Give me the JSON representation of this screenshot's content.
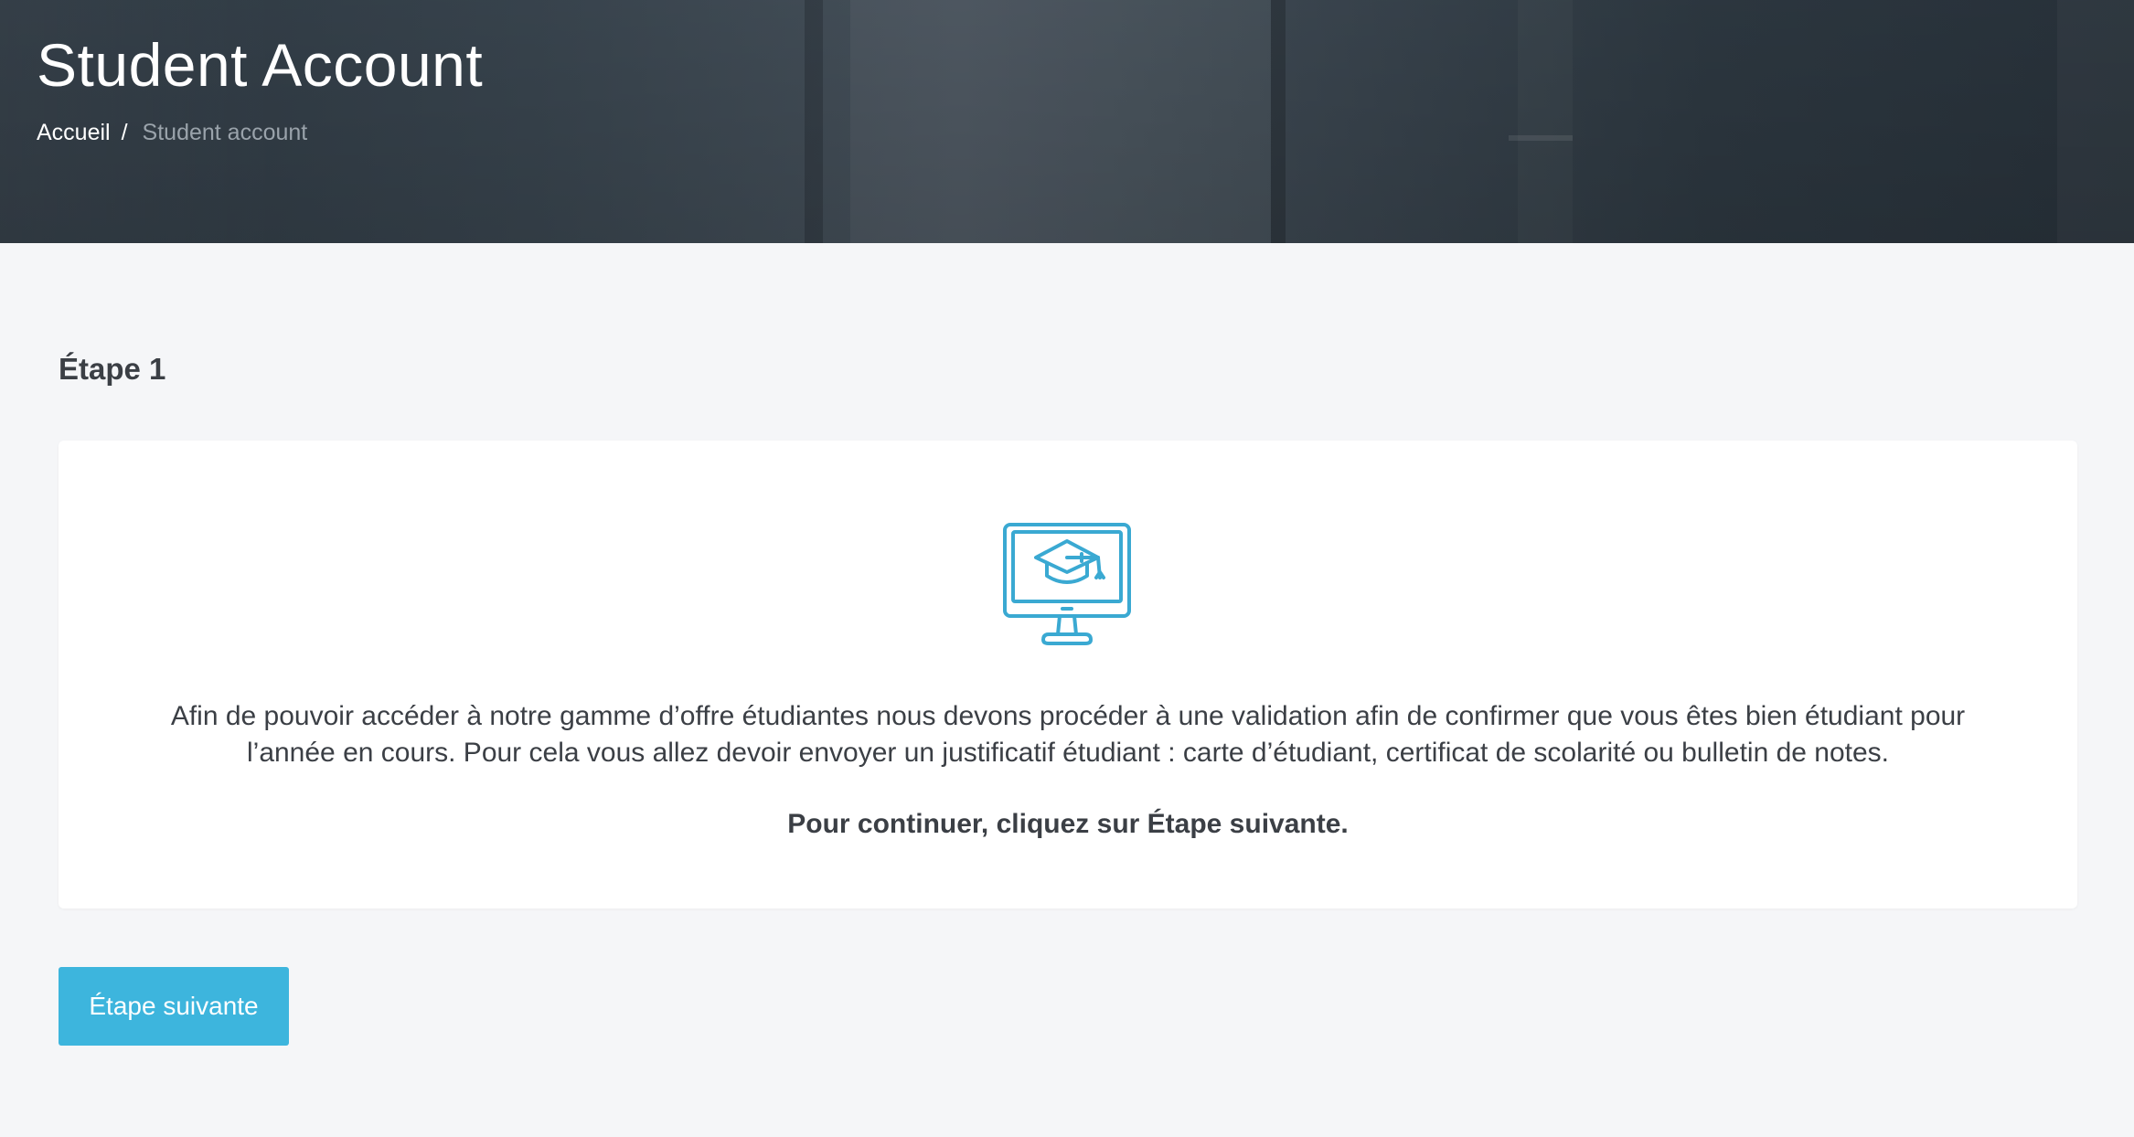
{
  "header": {
    "title": "Student Account",
    "breadcrumb": {
      "home": "Accueil",
      "separator": "/",
      "current": "Student account"
    }
  },
  "main": {
    "step_title": "Étape 1",
    "card": {
      "icon": "computer-graduation-cap-icon",
      "paragraph_lines": [
        "Afin de pouvoir accéder à notre gamme d’offre étudiantes nous devons procéder à une validation afin de confirmer que vous êtes bien étudiant pour",
        "l’année en cours. Pour cela vous allez devoir envoyer un justificatif étudiant : carte d’étudiant, certificat de scolarité ou bulletin de notes."
      ],
      "cta": "Pour continuer, cliquez sur Étape suivante."
    },
    "next_button_label": "Étape suivante"
  },
  "colors": {
    "accent": "#3db5dd",
    "text_dark": "#3b3f45",
    "page_background": "#f5f6f8",
    "breadcrumb_muted": "#9aa3ab"
  }
}
